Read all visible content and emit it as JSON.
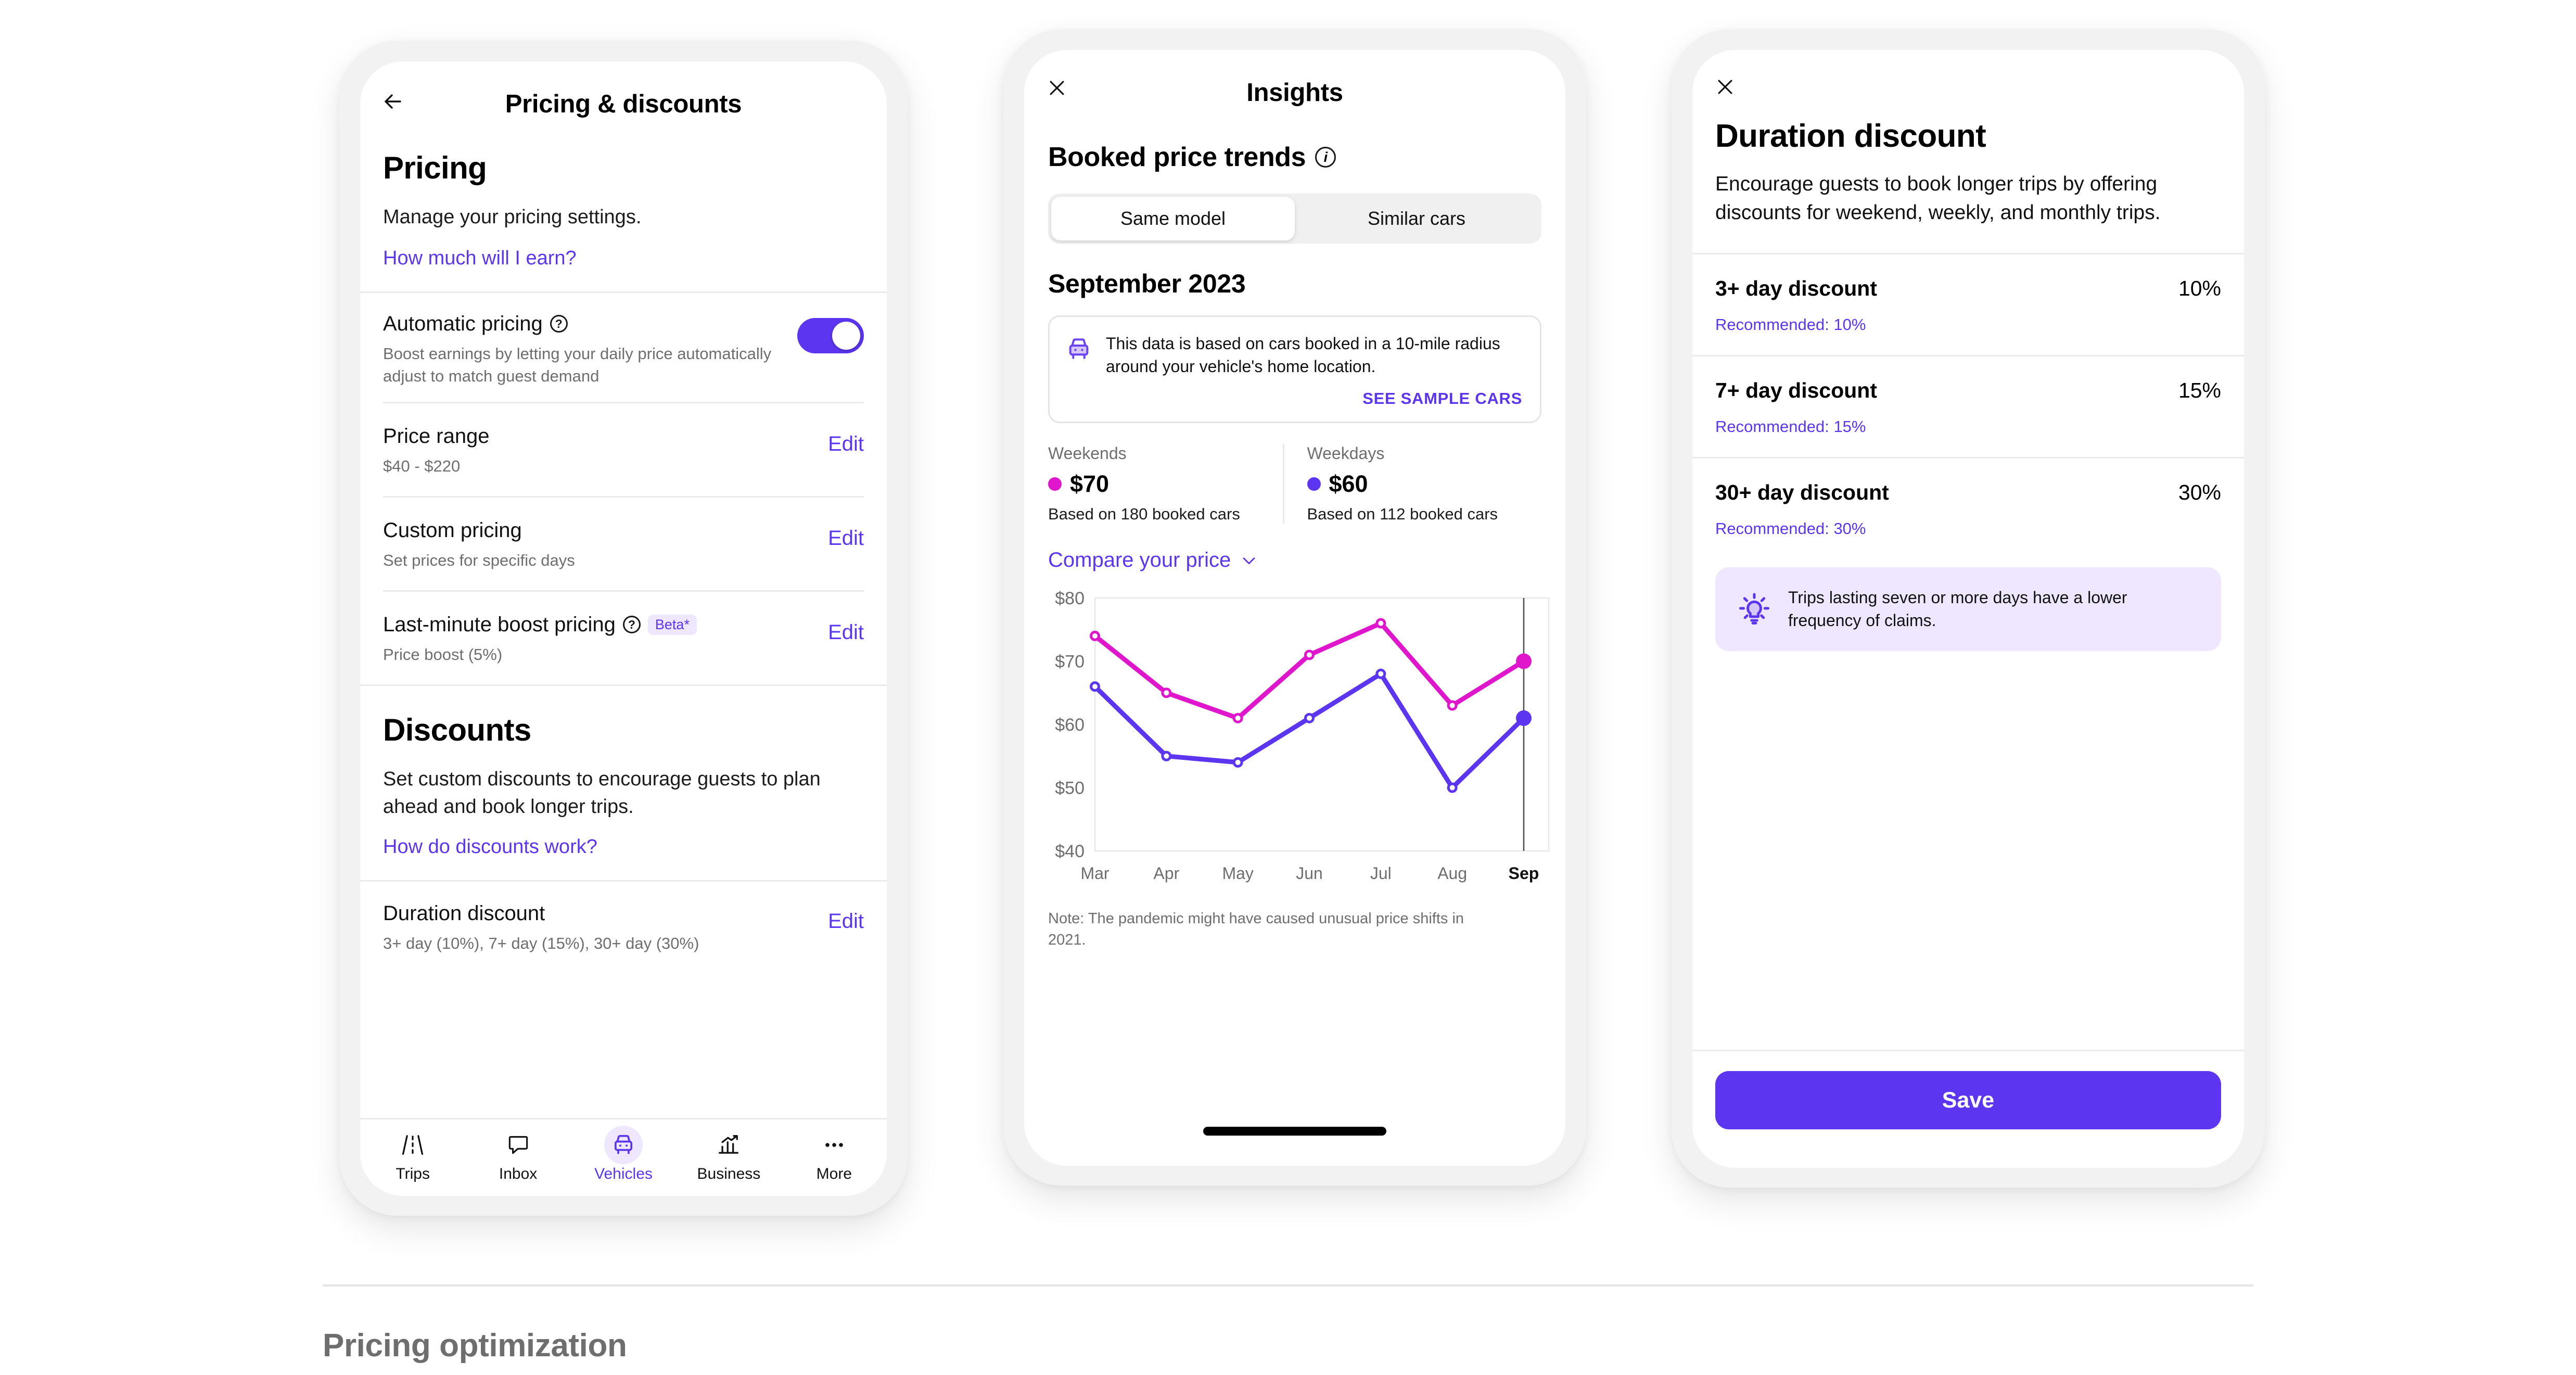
{
  "phone1": {
    "header": {
      "title": "Pricing & discounts",
      "back_icon": "arrow-left-icon"
    },
    "pricing": {
      "heading": "Pricing",
      "subtitle": "Manage your pricing settings.",
      "link": "How much will I earn?"
    },
    "rows": [
      {
        "title": "Automatic pricing",
        "help": "?",
        "subtitle": "Boost earnings by letting your daily price automatically adjust to match guest demand",
        "control": "toggle",
        "toggle_on": true
      },
      {
        "title": "Price range",
        "subtitle": "$40 - $220",
        "control": "edit",
        "action": "Edit"
      },
      {
        "title": "Custom pricing",
        "subtitle": "Set prices for specific days",
        "control": "edit",
        "action": "Edit"
      },
      {
        "title": "Last-minute boost pricing",
        "help": "?",
        "badge": "Beta*",
        "subtitle": "Price boost (5%)",
        "control": "edit",
        "action": "Edit"
      }
    ],
    "discounts": {
      "heading": "Discounts",
      "subtitle": "Set custom discounts to encourage guests to plan ahead and book longer trips.",
      "link": "How do discounts work?"
    },
    "duration_row": {
      "title": "Duration discount",
      "subtitle": "3+ day (10%), 7+ day (15%), 30+ day (30%)",
      "action": "Edit"
    },
    "tabbar": [
      {
        "label": "Trips",
        "icon": "road-icon",
        "active": false
      },
      {
        "label": "Inbox",
        "icon": "chat-bubble-icon",
        "active": false
      },
      {
        "label": "Vehicles",
        "icon": "car-front-icon",
        "active": true
      },
      {
        "label": "Business",
        "icon": "bar-chart-trend-icon",
        "active": false
      },
      {
        "label": "More",
        "icon": "ellipsis-icon",
        "active": false
      }
    ]
  },
  "phone2": {
    "header": {
      "title": "Insights",
      "close_icon": "close-icon"
    },
    "section_title": "Booked price trends",
    "info_icon": "info-circle-icon",
    "segments": [
      {
        "label": "Same model",
        "selected": true
      },
      {
        "label": "Similar cars",
        "selected": false
      }
    ],
    "month": "September 2023",
    "notice": {
      "icon": "car-front-icon",
      "text": "This data is based on cars booked in a 10-mile radius around your vehicle's home location.",
      "link": "SEE SAMPLE CARS"
    },
    "stats": [
      {
        "label": "Weekends",
        "value": "$70",
        "basis": "Based on 180 booked cars",
        "color": "#e016cc"
      },
      {
        "label": "Weekdays",
        "value": "$60",
        "basis": "Based on 112 booked cars",
        "color": "#5b35f0"
      }
    ],
    "compare": {
      "label": "Compare your price",
      "icon": "chevron-down-icon"
    },
    "note": "Note: The pandemic might have caused unusual price shifts in 2021.",
    "home_indicator": "home-bar"
  },
  "chart_data": {
    "type": "line",
    "title": "Booked price trends",
    "subtitle": "September 2023",
    "xlabel": "",
    "ylabel": "",
    "ylim": [
      40,
      80
    ],
    "yticks": [
      40,
      50,
      60,
      70,
      80
    ],
    "ytick_labels": [
      "$40",
      "$50",
      "$60",
      "$70",
      "$80"
    ],
    "categories": [
      "Mar",
      "Apr",
      "May",
      "Jun",
      "Jul",
      "Aug",
      "Sep"
    ],
    "highlighted_category": "Sep",
    "grid": false,
    "legend_position": "above-chart",
    "series": [
      {
        "name": "Weekends",
        "color": "#e016cc",
        "values": [
          74,
          65,
          61,
          71,
          76,
          63,
          70
        ]
      },
      {
        "name": "Weekdays",
        "color": "#5b35f0",
        "values": [
          66,
          55,
          54,
          61,
          68,
          50,
          61
        ]
      }
    ],
    "annotations": [
      {
        "type": "vline",
        "at": "Sep",
        "color": "#4a4a4a"
      },
      {
        "type": "text",
        "text": "Note: The pandemic might have caused unusual price shifts in 2021."
      }
    ]
  },
  "phone3": {
    "header": {
      "close_icon": "close-icon"
    },
    "title": "Duration discount",
    "subtitle": "Encourage guests to book longer trips by offering discounts for weekend, weekly, and monthly trips.",
    "discounts": [
      {
        "label": "3+ day discount",
        "value": "10%",
        "recommended": "Recommended: 10%"
      },
      {
        "label": "7+ day discount",
        "value": "15%",
        "recommended": "Recommended: 15%"
      },
      {
        "label": "30+ day discount",
        "value": "30%",
        "recommended": "Recommended: 30%"
      }
    ],
    "tip": {
      "icon": "lightbulb-icon",
      "text": "Trips lasting seven or more days have a lower frequency of claims."
    },
    "save_label": "Save"
  },
  "page": {
    "footer_heading": "Pricing optimization"
  },
  "colors": {
    "accent": "#5b35f0",
    "magenta": "#e016cc",
    "accent_bg": "#efe7ff",
    "divider": "#ebebeb"
  }
}
